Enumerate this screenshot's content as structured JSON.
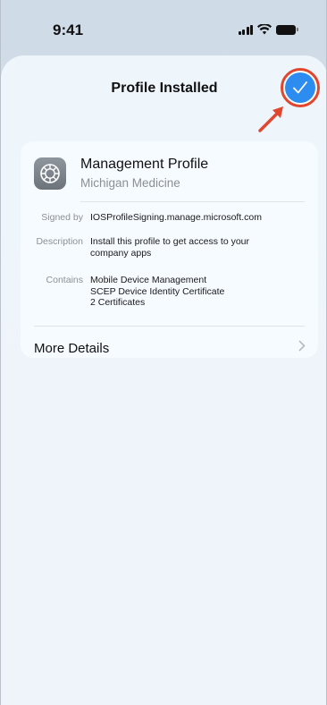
{
  "status_bar": {
    "time": "9:41"
  },
  "sheet": {
    "title": "Profile Installed"
  },
  "colors": {
    "accent": "#2d8cf0",
    "highlight": "#e1462f"
  },
  "profile": {
    "name": "Management Profile",
    "organization": "Michigan Medicine",
    "signed_by_label": "Signed by",
    "signed_by_value": "IOSProfileSigning.manage.microsoft.com",
    "description_label": "Description",
    "description_value": "Install this profile to get access to your company apps",
    "contains_label": "Contains",
    "contains_values": [
      "Mobile Device Management",
      "SCEP Device Identity Certificate",
      "2 Certificates"
    ],
    "more_details_label": "More Details"
  }
}
